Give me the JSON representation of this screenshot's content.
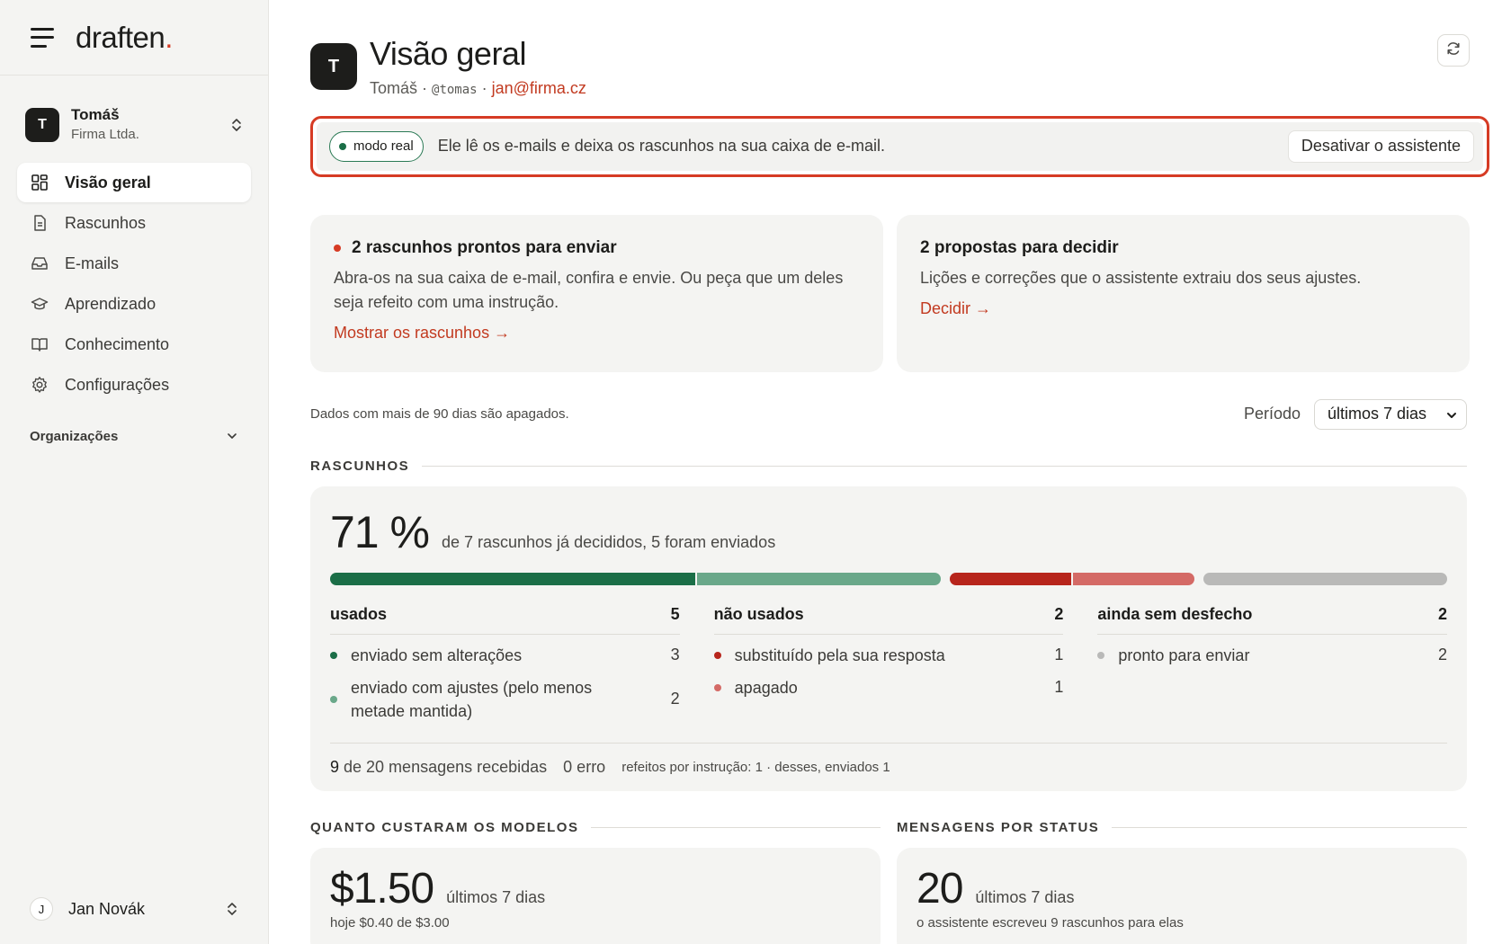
{
  "brand": {
    "name": "draften",
    "dot": "."
  },
  "account": {
    "initial": "T",
    "name": "Tomáš",
    "org": "Firma Ltda."
  },
  "nav": [
    {
      "label": "Visão geral",
      "icon": "grid-icon",
      "active": true
    },
    {
      "label": "Rascunhos",
      "icon": "document-icon",
      "active": false
    },
    {
      "label": "E-mails",
      "icon": "inbox-icon",
      "active": false
    },
    {
      "label": "Aprendizado",
      "icon": "graduation-cap-icon",
      "active": false
    },
    {
      "label": "Conhecimento",
      "icon": "book-icon",
      "active": false
    },
    {
      "label": "Configurações",
      "icon": "gear-icon",
      "active": false
    }
  ],
  "organizations_label": "Organizações",
  "user": {
    "initial": "J",
    "name": "Jan Novák"
  },
  "header": {
    "initial": "T",
    "title": "Visão geral",
    "name": "Tomáš",
    "sep": " · ",
    "handle": "@tomas",
    "email": "jan@firma.cz"
  },
  "mode": {
    "pill": "modo real",
    "text": "Ele lê os e-mails e deixa os rascunhos na sua caixa de e-mail.",
    "button": "Desativar o assistente"
  },
  "cards": {
    "drafts_ready": {
      "title": "2 rascunhos prontos para enviar",
      "text": "Abra-os na sua caixa de e-mail, confira e envie. Ou peça que um deles seja refeito com uma instrução.",
      "link": "Mostrar os rascunhos →"
    },
    "proposals": {
      "title": "2 propostas para decidir",
      "text": "Lições e correções que o assistente extraiu dos seus ajustes.",
      "link": "Decidir →"
    }
  },
  "filters": {
    "note": "Dados com mais de 90 dias são apagados.",
    "period_label": "Período",
    "period_value": "últimos 7 dias"
  },
  "drafts": {
    "section": "RASCUNHOS",
    "pct": "71 %",
    "pct_desc": "de 7 rascunhos já decididos, 5 foram enviados",
    "bars": [
      {
        "value": 3,
        "color": "#1b6e47"
      },
      {
        "value": 2,
        "color": "#6aa88a"
      },
      {
        "value": 1,
        "color": "#b7251c"
      },
      {
        "value": 1,
        "color": "#d46a66"
      },
      {
        "value": 2,
        "color": "#b9b9b8"
      }
    ],
    "groups": [
      {
        "title": "usados",
        "count": "5",
        "rows": [
          {
            "label": "enviado sem alterações",
            "count": "3",
            "color": "#1b6e47"
          },
          {
            "label": "enviado com ajustes (pelo menos metade mantida)",
            "count": "2",
            "color": "#6aa88a"
          }
        ]
      },
      {
        "title": "não usados",
        "count": "2",
        "rows": [
          {
            "label": "substituído pela sua resposta",
            "count": "1",
            "color": "#b7251c"
          },
          {
            "label": "apagado",
            "count": "1",
            "color": "#d46a66"
          }
        ]
      },
      {
        "title": "ainda sem desfecho",
        "count": "2",
        "rows": [
          {
            "label": "pronto para enviar",
            "count": "2",
            "color": "#b9b9b8"
          }
        ]
      }
    ],
    "footer": {
      "received_num": "9",
      "received_text": " de 20 mensagens recebidas",
      "errors": "0 erro",
      "redone": "refeitos por instrução: 1 · desses, enviados 1"
    }
  },
  "costs": {
    "section": "QUANTO CUSTARAM OS MODELOS",
    "value": "$1.50",
    "period": "últimos 7 dias",
    "today": "hoje $0.40 de $3.00"
  },
  "status": {
    "section": "MENSAGENS POR STATUS",
    "value": "20",
    "period": "últimos 7 dias",
    "note": "o assistente escreveu 9 rascunhos para elas"
  }
}
